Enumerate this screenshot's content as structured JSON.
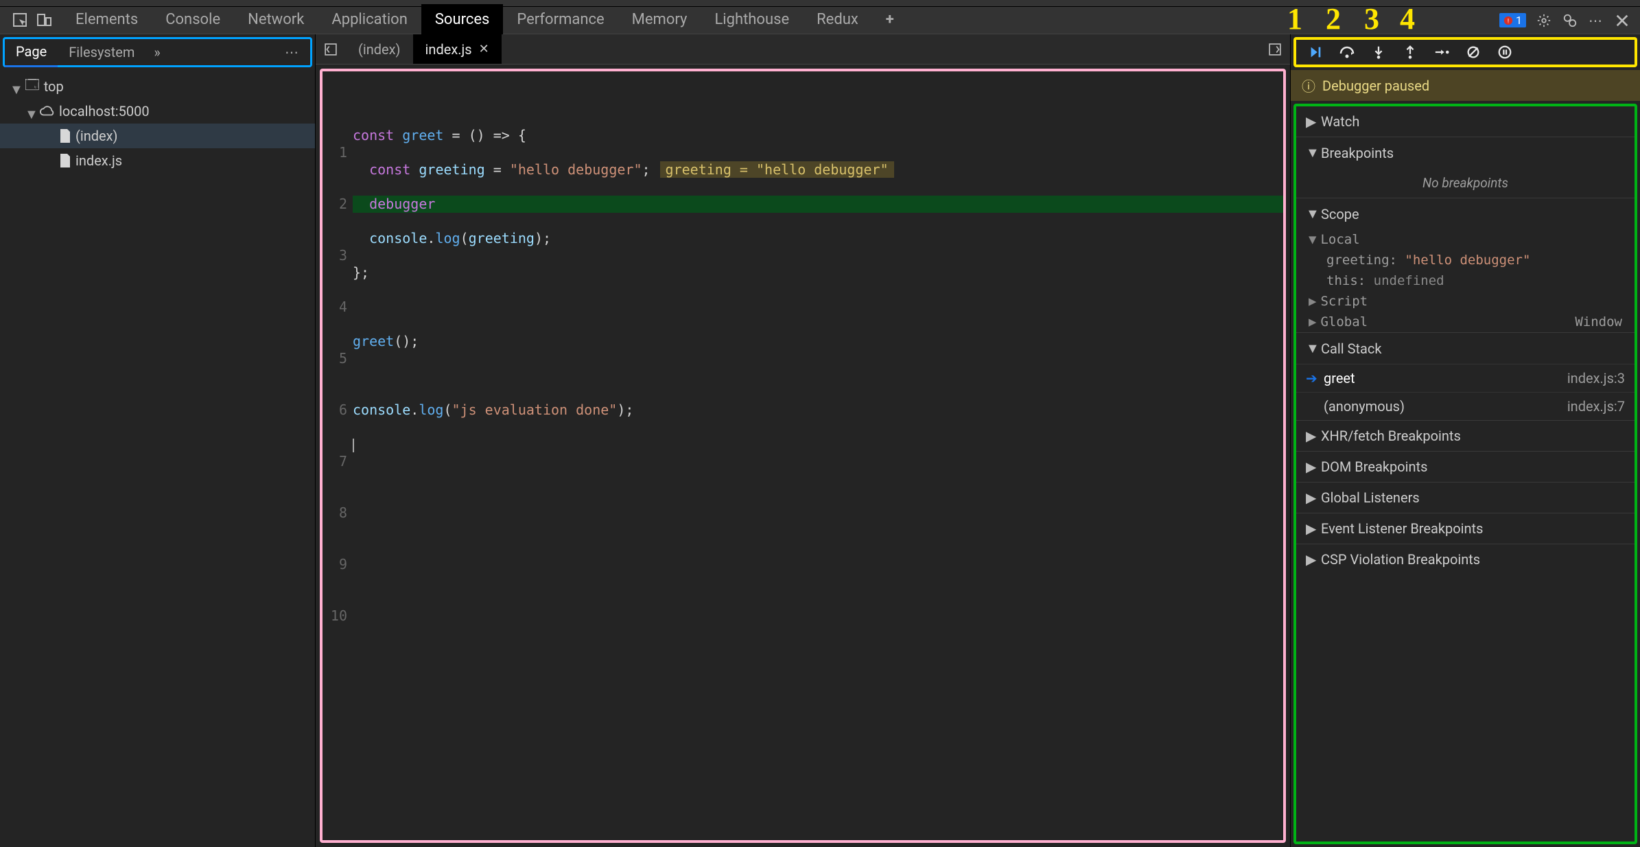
{
  "main_tabs": {
    "elements": "Elements",
    "console": "Console",
    "network": "Network",
    "application": "Application",
    "sources": "Sources",
    "performance": "Performance",
    "memory": "Memory",
    "lighthouse": "Lighthouse",
    "redux": "Redux",
    "active": "sources"
  },
  "errors_badge": "1",
  "navigator": {
    "tabs": {
      "page": "Page",
      "filesystem": "Filesystem"
    },
    "tree": {
      "root": "top",
      "host": "localhost:5000",
      "files": {
        "index_page": "(index)",
        "index_js": "index.js"
      }
    }
  },
  "open_files": {
    "index_page": "(index)",
    "index_js": "index.js"
  },
  "editor": {
    "lines": {
      "1": "const greet = () => {",
      "2": "  const greeting = \"hello debugger\";",
      "2_hint": "greeting = \"hello debugger\"",
      "3": "  debugger",
      "4": "  console.log(greeting);",
      "5": "};",
      "6": "",
      "7": "greet();",
      "8": "",
      "9": "console.log(\"js evaluation done\");",
      "10": ""
    },
    "line_numbers": [
      "1",
      "2",
      "3",
      "4",
      "5",
      "6",
      "7",
      "8",
      "9",
      "10"
    ],
    "highlighted_line": 3
  },
  "debugger": {
    "paused_label": "Debugger paused",
    "sections": {
      "watch": "Watch",
      "breakpoints": "Breakpoints",
      "no_breakpoints": "No breakpoints",
      "scope": "Scope",
      "call_stack": "Call Stack",
      "xhr": "XHR/fetch Breakpoints",
      "dom": "DOM Breakpoints",
      "global_listeners": "Global Listeners",
      "event_listener": "Event Listener Breakpoints",
      "csp": "CSP Violation Breakpoints"
    },
    "scope": {
      "local_label": "Local",
      "greeting_key": "greeting:",
      "greeting_val": "\"hello debugger\"",
      "this_key": "this:",
      "this_val": "undefined",
      "script_label": "Script",
      "global_label": "Global",
      "global_right": "Window"
    },
    "call_stack": [
      {
        "name": "greet",
        "loc": "index.js:3",
        "active": true
      },
      {
        "name": "(anonymous)",
        "loc": "index.js:7",
        "active": false
      }
    ]
  },
  "annotations": {
    "n1": "1",
    "n2": "2",
    "n3": "3",
    "n4": "4"
  }
}
